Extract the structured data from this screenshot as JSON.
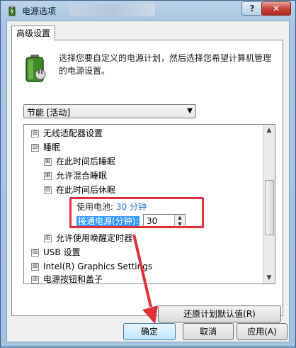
{
  "window": {
    "title": "电源选项",
    "help_label": "?",
    "close_label": "✕"
  },
  "tab": {
    "label": "高级设置"
  },
  "description": "选择您要自定义的电源计划，然后选择您希望计算机管理的电源设置。",
  "plan_select": {
    "value": "节能 [活动]",
    "arrow": "▼"
  },
  "tree": {
    "collapsed_sign": "⊞",
    "expanded_sign": "⊟",
    "items": [
      {
        "label": "无线适配器设置",
        "state": "collapsed",
        "level": 0
      },
      {
        "label": "睡眠",
        "state": "expanded",
        "level": 0
      },
      {
        "label": "在此时间后睡眠",
        "state": "collapsed",
        "level": 1
      },
      {
        "label": "允许混合睡眠",
        "state": "collapsed",
        "level": 1
      },
      {
        "label": "在此时间后休眠",
        "state": "expanded",
        "level": 1
      },
      {
        "label": "允许使用唤醒定时器",
        "state": "collapsed",
        "level": 1
      },
      {
        "label": "USB 设置",
        "state": "collapsed",
        "level": 0
      },
      {
        "label": "Intel(R) Graphics Settings",
        "state": "collapsed",
        "level": 0
      },
      {
        "label": "电源按钮和盖子",
        "state": "collapsed",
        "level": 0
      }
    ],
    "battery_setting": {
      "label": "使用电池:",
      "value": "30 分钟"
    },
    "plugged_setting": {
      "label": "接通电源(分钟):",
      "value": "30"
    }
  },
  "buttons": {
    "restore": "还原计划默认值(R)",
    "ok": "确定",
    "cancel": "取消",
    "apply": "应用(A)"
  },
  "colors": {
    "highlight_box": "#e0303a",
    "selection": "#3399ff",
    "value_blue": "#1f6fd0"
  }
}
